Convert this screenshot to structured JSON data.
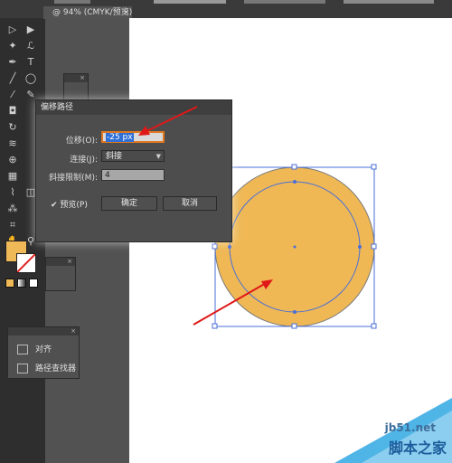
{
  "document": {
    "tab_title": "@ 94% (CMYK/预览)",
    "close_symbol": "×"
  },
  "toolbar": {
    "icons": [
      "selection-icon",
      "direct-selection-icon",
      "magic-wand-icon",
      "lasso-icon",
      "pen-icon",
      "type-icon",
      "line-icon",
      "ellipse-icon",
      "paintbrush-icon",
      "pencil-icon",
      "eraser-icon",
      "rotate-icon",
      "scale-icon",
      "warp-icon",
      "shape-builder-icon",
      "perspective-icon",
      "mesh-icon",
      "gradient-icon",
      "eyedropper-icon",
      "blend-icon",
      "symbol-sprayer-icon",
      "graph-icon",
      "artboard-icon",
      "slice-icon",
      "hand-icon",
      "zoom-icon"
    ]
  },
  "colors": {
    "fill": "#f0b957",
    "stroke": "#ffffff",
    "circle_fill": "#efb855",
    "circle_stroke": "#7a7a7a",
    "selection": "#4a6fd8",
    "arrow": "#e01818"
  },
  "dialog": {
    "title": "偏移路径",
    "offset": {
      "label": "位移(O):",
      "value": "-25 px"
    },
    "joins": {
      "label": "连接(J):",
      "value": "斜接"
    },
    "miter": {
      "label": "斜接限制(M):",
      "value": "4"
    },
    "preview": {
      "label": "预览(P)",
      "check": "✔"
    },
    "ok_label": "确定",
    "cancel_label": "取消"
  },
  "align_panel": {
    "items": [
      "对齐",
      "路径查找器"
    ]
  },
  "watermark": {
    "site": "jb51.net",
    "name": "脚本之家"
  }
}
